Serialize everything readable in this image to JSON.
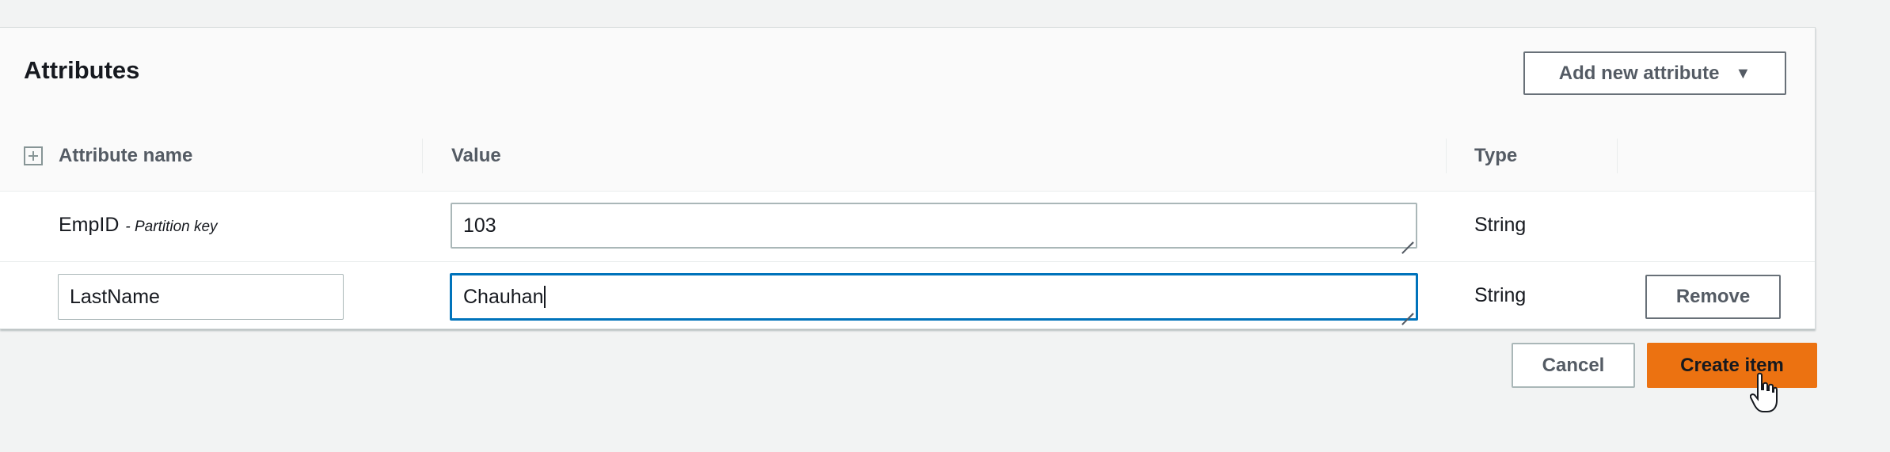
{
  "panel": {
    "title": "Attributes",
    "add_button_label": "Add new attribute",
    "add_button_icon": "caret-down-icon"
  },
  "table": {
    "headers": {
      "name": "Attribute name",
      "value": "Value",
      "type": "Type"
    },
    "rows": [
      {
        "name": "EmpID",
        "key_hint": "- Partition key",
        "value": "103",
        "type": "String"
      },
      {
        "name": "LastName",
        "value": "Chauhan",
        "type": "String",
        "remove_label": "Remove"
      }
    ]
  },
  "footer": {
    "cancel_label": "Cancel",
    "create_label": "Create item"
  },
  "colors": {
    "primary": "#ec7211",
    "focus": "#0073bb"
  }
}
